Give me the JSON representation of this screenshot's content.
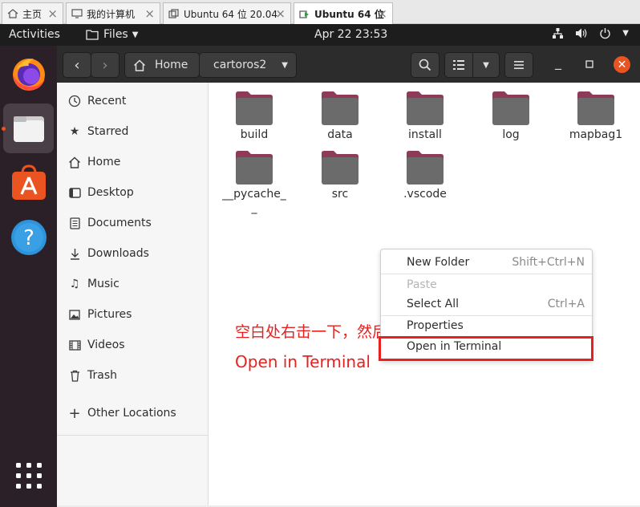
{
  "vm_tabs": [
    {
      "label": "主页",
      "icon": "home-icon"
    },
    {
      "label": "我的计算机",
      "icon": "computer-icon"
    },
    {
      "label": "Ubuntu 64 位 20.04",
      "icon": "vm-icon"
    },
    {
      "label": "Ubuntu 64 位",
      "icon": "vm-running-icon",
      "active": true
    }
  ],
  "topbar": {
    "activities": "Activities",
    "app_menu": "Files",
    "clock": "Apr 22  23:53"
  },
  "dock": [
    "firefox",
    "files",
    "software",
    "help",
    "show-apps"
  ],
  "headerbar": {
    "path_home": "Home",
    "path_current": "cartoros2"
  },
  "sidebar": {
    "items": [
      {
        "label": "Recent",
        "icon": "clock-icon"
      },
      {
        "label": "Starred",
        "icon": "star-icon"
      },
      {
        "label": "Home",
        "icon": "home-icon"
      },
      {
        "label": "Desktop",
        "icon": "desktop-icon"
      },
      {
        "label": "Documents",
        "icon": "document-icon"
      },
      {
        "label": "Downloads",
        "icon": "download-icon"
      },
      {
        "label": "Music",
        "icon": "music-icon"
      },
      {
        "label": "Pictures",
        "icon": "picture-icon"
      },
      {
        "label": "Videos",
        "icon": "video-icon"
      },
      {
        "label": "Trash",
        "icon": "trash-icon"
      }
    ],
    "other_locations": "Other Locations"
  },
  "folders": [
    "build",
    "data",
    "install",
    "log",
    "mapbag1",
    "__pycache__",
    "src",
    ".vscode"
  ],
  "annotation": {
    "line1": "空白处右击一下，然后选择",
    "line2": "Open in Terminal"
  },
  "context_menu": {
    "items": [
      {
        "label": "New Folder",
        "accel": "Shift+Ctrl+N"
      },
      {
        "label": "Paste",
        "accel": ""
      },
      {
        "label": "Select All",
        "accel": "Ctrl+A"
      },
      {
        "label": "Properties",
        "accel": ""
      },
      {
        "label": "Open in Terminal",
        "accel": ""
      }
    ]
  },
  "colors": {
    "ubuntu_orange": "#e95420",
    "folder_body": "#6b6b6b",
    "folder_tab": "#8e3b5a",
    "annotation_red": "#e8201e"
  }
}
